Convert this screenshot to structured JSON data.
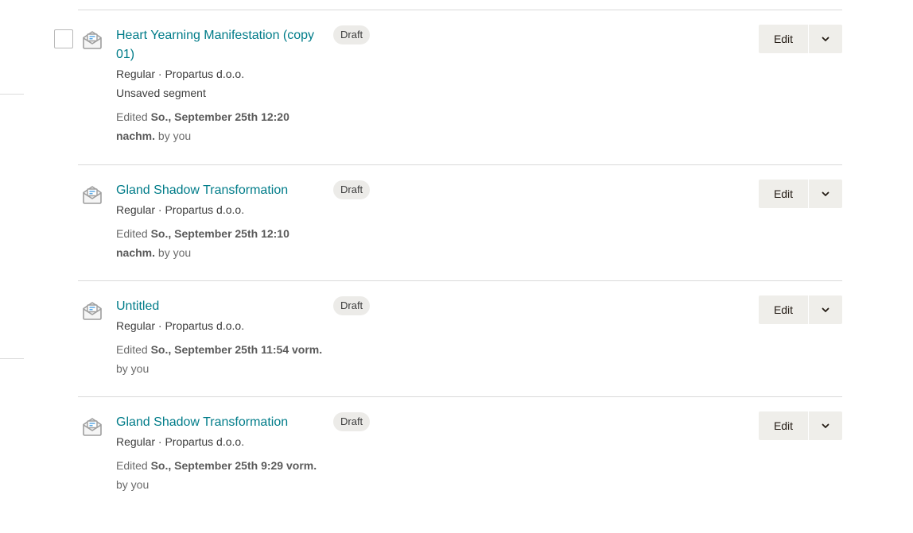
{
  "campaigns": [
    {
      "title": "Heart Yearning Manifestation (copy 01)",
      "meta": "Regular · Propartus d.o.o.",
      "segment": "Unsaved segment",
      "edited_prefix": "Edited ",
      "edited_date": "So., September 25th 12:20 nachm.",
      "edited_suffix": " by you",
      "status": "Draft",
      "edit_label": "Edit",
      "has_checkbox": true
    },
    {
      "title": "Gland Shadow Transformation",
      "meta": "Regular · Propartus d.o.o.",
      "edited_prefix": "Edited ",
      "edited_date": "So., September 25th 12:10 nachm.",
      "edited_suffix": " by you",
      "status": "Draft",
      "edit_label": "Edit"
    },
    {
      "title": "Untitled",
      "meta": "Regular · Propartus d.o.o.",
      "edited_prefix": "Edited ",
      "edited_date": "So., September 25th 11:54 vorm.",
      "edited_suffix": " by you",
      "status": "Draft",
      "edit_label": "Edit"
    },
    {
      "title": "Gland Shadow Transformation",
      "meta": "Regular · Propartus d.o.o.",
      "edited_prefix": "Edited ",
      "edited_date": "So., September 25th 9:29 vorm.",
      "edited_suffix": " by you",
      "status": "Draft",
      "edit_label": "Edit"
    }
  ],
  "icons": {
    "campaign": "email-campaign-icon",
    "menu": "chevron-down-icon"
  },
  "colors": {
    "link": "#007c89",
    "badge_bg": "#ecebe8",
    "button_bg": "#efeeea",
    "divider": "#d9d9d9"
  }
}
